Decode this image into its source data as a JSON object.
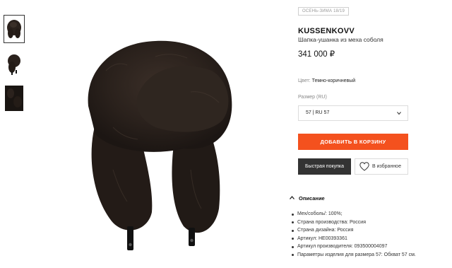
{
  "gallery": {
    "thumbnails": [
      {
        "icon": "fur-hat-front",
        "active": true
      },
      {
        "icon": "fur-hat-side",
        "active": false
      },
      {
        "icon": "fur-hat-closeup",
        "active": false
      }
    ],
    "main_image_icon": "fur-hat-main"
  },
  "product": {
    "season": "ОСЕНЬ-ЗИМА 18/19",
    "brand": "KUSSENKOVV",
    "subtitle": "Шапка-ушанка из меха соболя",
    "price": "341 000 ₽",
    "color_label": "Цвет:",
    "color_value": "Темно-коричневый",
    "size_label": "Размер (RU)",
    "size_selected": "57 | RU 57"
  },
  "actions": {
    "add_to_cart": "ДОБАВИТЬ В КОРЗИНУ",
    "quick_buy": "Быстрая покупка",
    "favorite": "В избранное"
  },
  "description": {
    "header": "Описание",
    "items": [
      "Мех/соболь/: 100%;",
      "Страна производства: Россия",
      "Страна дизайна: Россия",
      "Артикул: HE00393361",
      "Артикул производителя: 093500004097",
      "Параметры изделия для размера 57: Обхват 57 см."
    ]
  },
  "colors": {
    "accent": "#f4511e",
    "dark_button": "#333333",
    "fur": "#2a211c"
  }
}
